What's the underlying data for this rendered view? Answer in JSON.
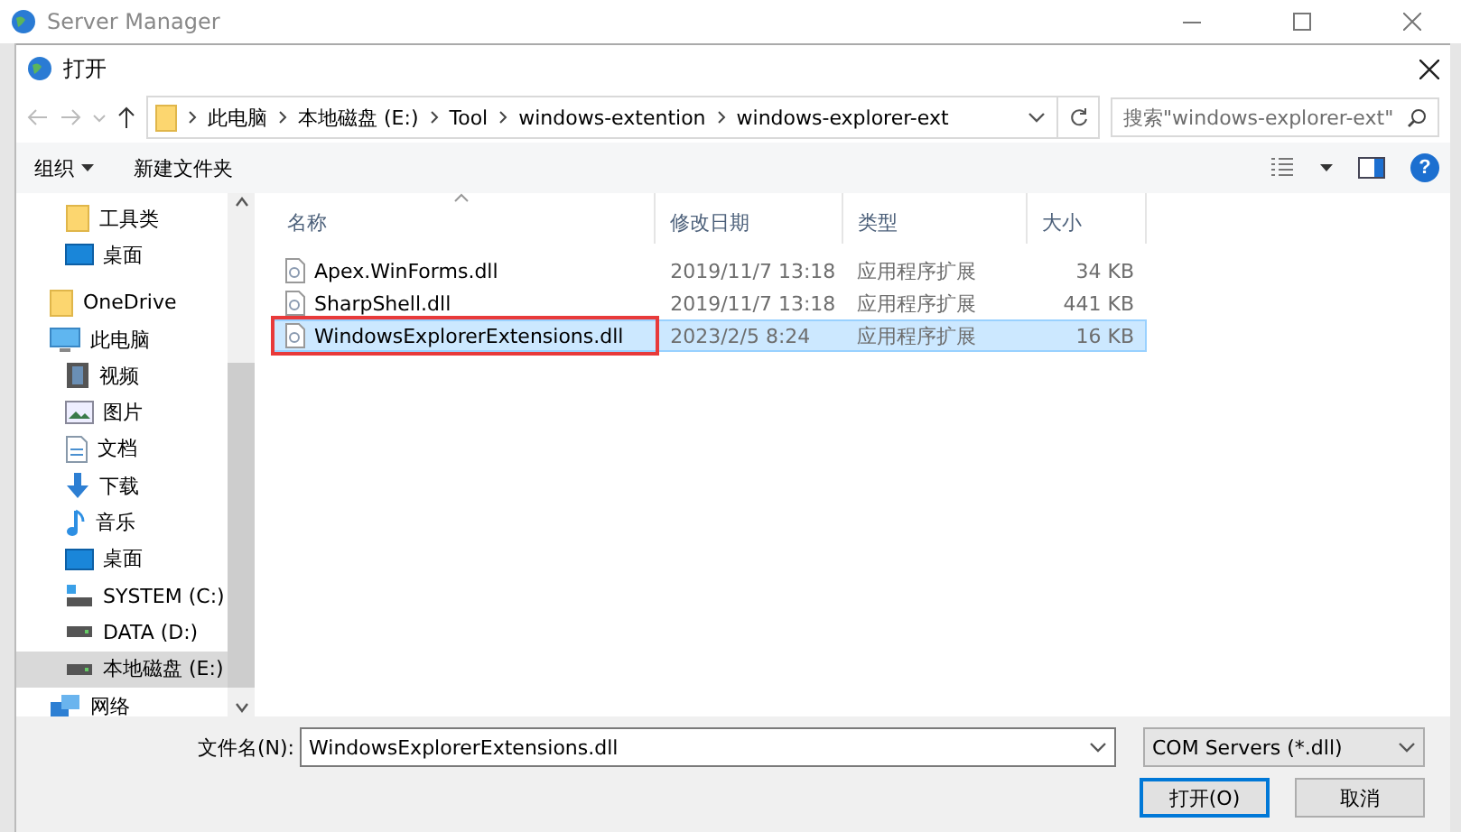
{
  "background_window": {
    "title": "Server Manager"
  },
  "dialog": {
    "title": "打开"
  },
  "address_bar": {
    "crumbs": [
      "此电脑",
      "本地磁盘 (E:)",
      "Tool",
      "windows-extention",
      "windows-explorer-ext"
    ]
  },
  "search": {
    "placeholder": "搜索\"windows-explorer-ext\""
  },
  "toolbar": {
    "organize": "组织",
    "new_folder": "新建文件夹",
    "help": "?"
  },
  "sidebar": {
    "quick_access_items": [
      {
        "label": "工具类",
        "kind": "folder",
        "selected": false
      },
      {
        "label": "桌面",
        "kind": "desktop",
        "selected": false
      }
    ],
    "items": [
      {
        "label": "OneDrive",
        "kind": "folder",
        "selected": false
      },
      {
        "label": "此电脑",
        "kind": "pc",
        "selected": false,
        "children": [
          {
            "label": "视频",
            "kind": "video",
            "selected": false
          },
          {
            "label": "图片",
            "kind": "picture",
            "selected": false
          },
          {
            "label": "文档",
            "kind": "document",
            "selected": false
          },
          {
            "label": "下载",
            "kind": "download",
            "selected": false
          },
          {
            "label": "音乐",
            "kind": "music",
            "selected": false
          },
          {
            "label": "桌面",
            "kind": "desktop",
            "selected": false
          },
          {
            "label": "SYSTEM (C:)",
            "kind": "system-drive",
            "selected": false
          },
          {
            "label": "DATA (D:)",
            "kind": "drive",
            "selected": false
          },
          {
            "label": "本地磁盘 (E:)",
            "kind": "drive",
            "selected": true
          }
        ]
      },
      {
        "label": "网络",
        "kind": "network",
        "selected": false
      }
    ]
  },
  "table": {
    "columns": [
      {
        "label": "名称",
        "sorted": true
      },
      {
        "label": "修改日期",
        "sorted": false
      },
      {
        "label": "类型",
        "sorted": false
      },
      {
        "label": "大小",
        "sorted": false
      }
    ],
    "rows": [
      {
        "name": "Apex.WinForms.dll",
        "modified": "2019/11/7 13:18",
        "type": "应用程序扩展",
        "size": "34 KB",
        "selected": false,
        "highlighted": false
      },
      {
        "name": "SharpShell.dll",
        "modified": "2019/11/7 13:18",
        "type": "应用程序扩展",
        "size": "441 KB",
        "selected": false,
        "highlighted": false
      },
      {
        "name": "WindowsExplorerExtensions.dll",
        "modified": "2023/2/5 8:24",
        "type": "应用程序扩展",
        "size": "16 KB",
        "selected": true,
        "highlighted": true
      }
    ]
  },
  "file_name": {
    "label": "文件名(N):",
    "value": "WindowsExplorerExtensions.dll"
  },
  "filter": {
    "value": "COM Servers (*.dll)"
  },
  "buttons": [
    {
      "label": "打开(O)",
      "primary": true
    },
    {
      "label": "取消",
      "primary": false
    }
  ]
}
